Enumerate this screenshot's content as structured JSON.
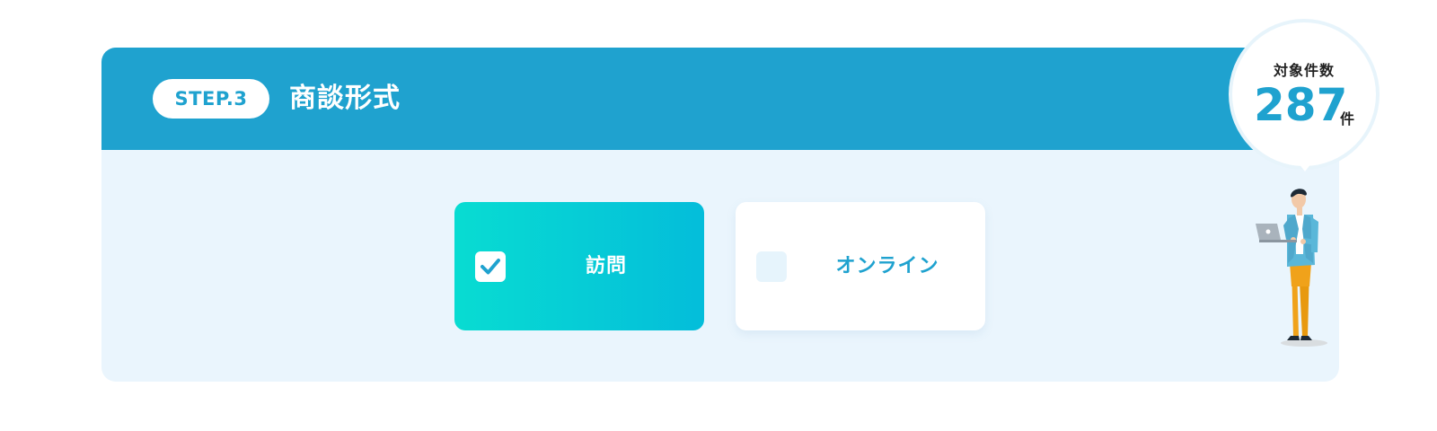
{
  "step": {
    "badge": "STEP.3",
    "title": "商談形式"
  },
  "options": [
    {
      "label": "訪問",
      "checked": true
    },
    {
      "label": "オンライン",
      "checked": false
    }
  ],
  "count": {
    "label": "対象件数",
    "value": "287",
    "unit": "件"
  },
  "colors": {
    "header": "#1fa2cf",
    "card_bg": "#eaf5fd",
    "selected_gradient_start": "#08dcd2",
    "selected_gradient_end": "#04bdda"
  },
  "icons": {
    "check": "check-icon",
    "person": "person-with-laptop-illustration"
  }
}
